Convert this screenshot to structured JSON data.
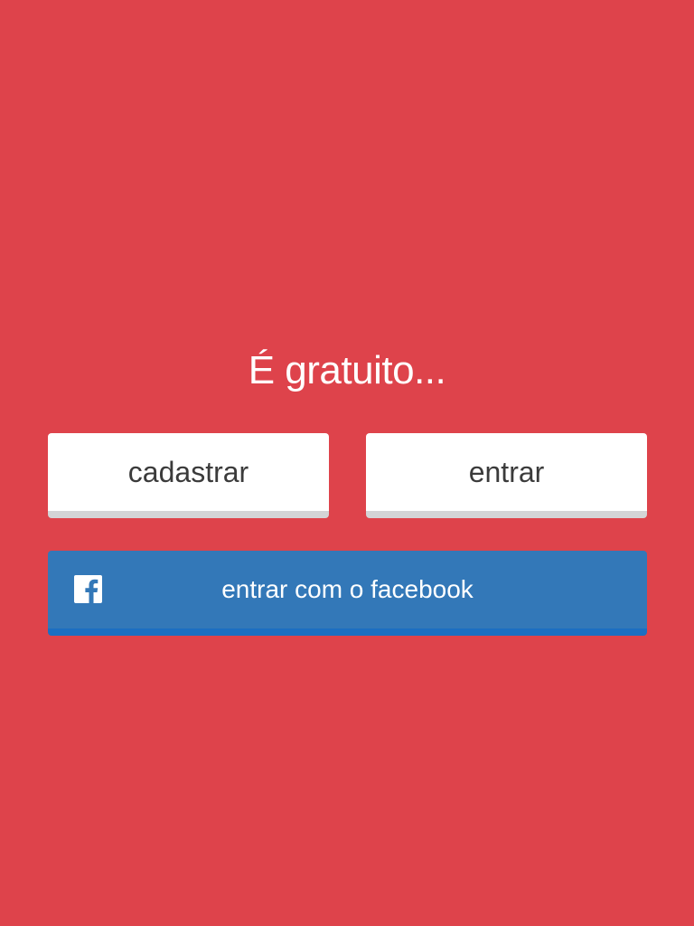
{
  "headline": "É gratuito...",
  "buttons": {
    "signup_label": "cadastrar",
    "login_label": "entrar",
    "facebook_label": "entrar com o facebook"
  },
  "icons": {
    "facebook": "facebook-icon"
  },
  "colors": {
    "background": "#DE434B",
    "button_white": "#FFFFFF",
    "button_white_shadow": "#D4D4D6",
    "facebook_blue": "#3378B8",
    "facebook_blue_shadow": "#1C6FC1"
  }
}
